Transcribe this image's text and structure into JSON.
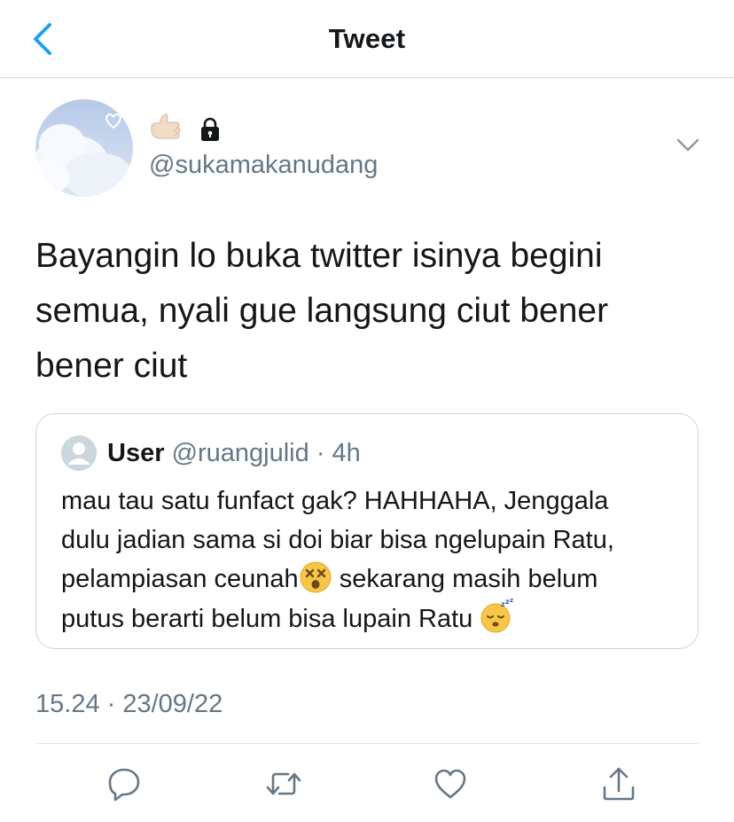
{
  "header": {
    "title": "Tweet",
    "back_icon": "chevron-left-icon"
  },
  "tweet": {
    "name_icons": [
      "call-me-hand-emoji",
      "lock-icon"
    ],
    "handle": "@sukamakanudang",
    "text_lines": [
      "Bayangin lo buka twitter isinya begini",
      "semua, nyali gue langsung ciut bener",
      "bener ciut"
    ],
    "timestamp": "15.24 · 23/09/22"
  },
  "quote": {
    "name": "User",
    "handle": "@ruangjulid",
    "separator": " · ",
    "age": "4h",
    "lines": [
      "mau tau satu funfact gak? HAHHAHA, Jenggala",
      "dulu jadian sama si doi biar bisa ngelupain Ratu,",
      "pelampiasan ceunah",
      " sekarang masih belum",
      "putus berarti belum bisa lupain Ratu "
    ],
    "emojis": [
      "dizzy-face-emoji",
      "sleeping-face-emoji"
    ]
  },
  "actions": [
    "reply-icon",
    "retweet-icon",
    "like-icon",
    "share-icon"
  ],
  "colors": {
    "accent": "#1da1f2",
    "text": "#14171a",
    "secondary": "#657786",
    "border": "#ccd6dd",
    "divider": "#e1e8ed",
    "icon": "#657786"
  }
}
